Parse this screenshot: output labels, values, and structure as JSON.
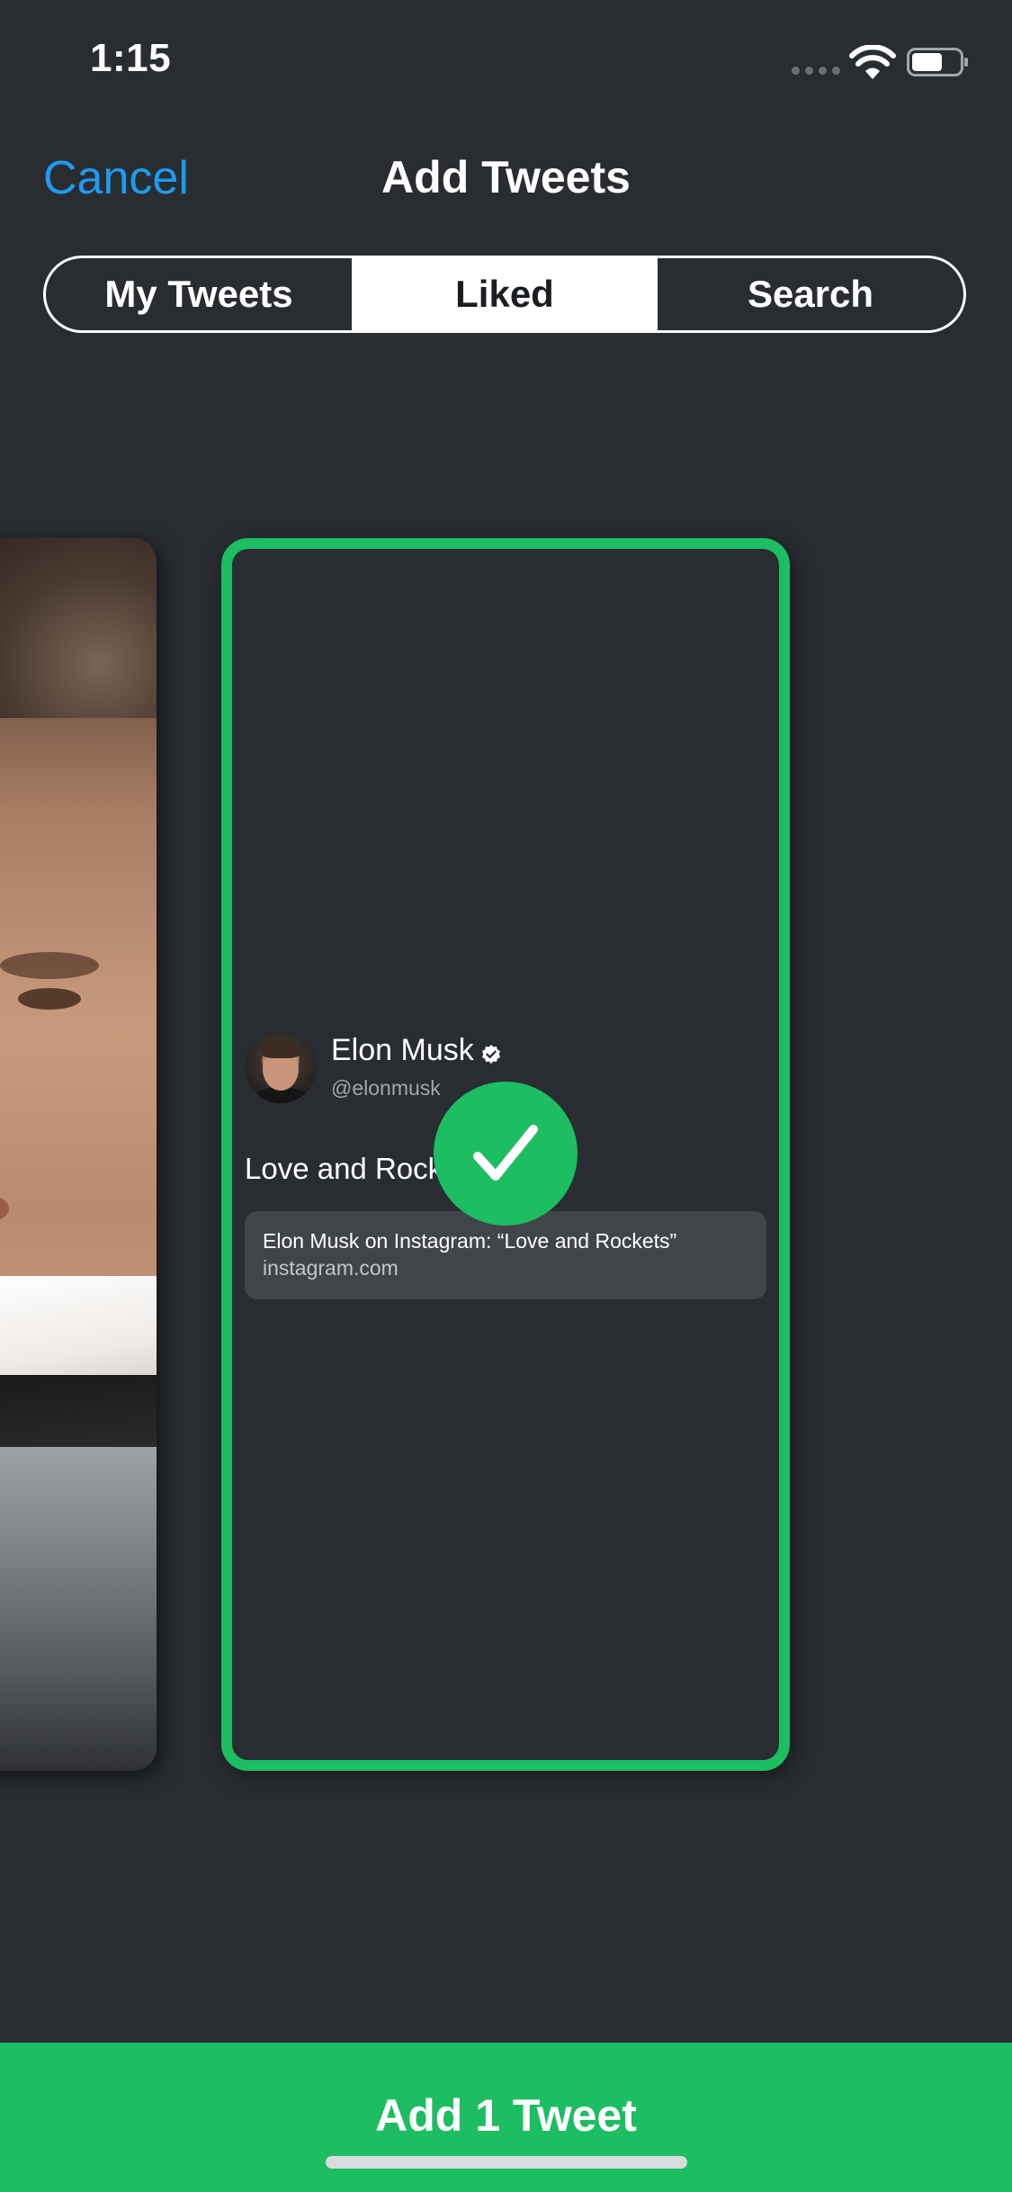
{
  "status_bar": {
    "time": "1:15"
  },
  "nav": {
    "cancel_label": "Cancel",
    "title": "Add Tweets"
  },
  "tabs": [
    {
      "label": "My Tweets",
      "selected": false
    },
    {
      "label": "Liked",
      "selected": true
    },
    {
      "label": "Search",
      "selected": false
    }
  ],
  "tweet": {
    "author_name": "Elon Musk",
    "author_handle": "@elonmusk",
    "verified": true,
    "text": "Love and Rock",
    "link_title": "Elon Musk on Instagram: “Love and Rockets”",
    "link_domain": "instagram.com",
    "selected": true
  },
  "action": {
    "add_label": "Add 1 Tweet"
  },
  "colors": {
    "background": "#292d32",
    "accent_green": "#1dbd62",
    "link_blue": "#1d9bf0",
    "segment_border": "#ffffff"
  },
  "icons": [
    "signal-icon",
    "wifi-icon",
    "battery-icon",
    "verified-icon",
    "checkmark-icon"
  ]
}
